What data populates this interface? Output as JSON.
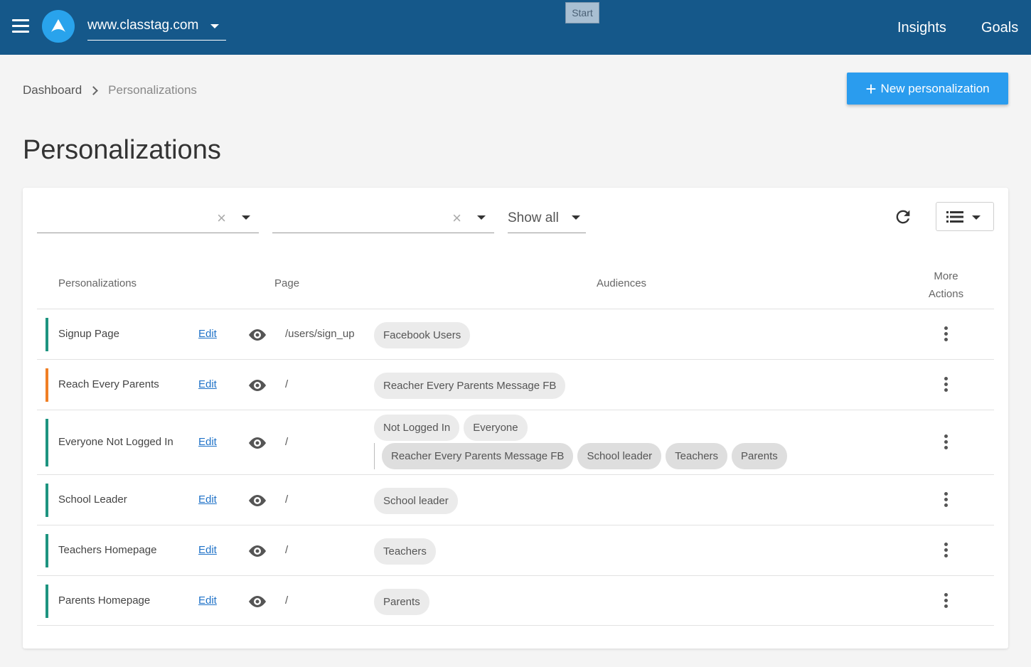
{
  "topbar": {
    "site": "www.classtag.com",
    "start_badge": "Start",
    "nav": {
      "insights": "Insights",
      "goals": "Goals"
    },
    "colors": {
      "bar": "#15588a",
      "logo": "#29a3ec"
    }
  },
  "breadcrumb": {
    "root": "Dashboard",
    "current": "Personalizations"
  },
  "actions": {
    "new_label": "New personalization"
  },
  "page_title": "Personalizations",
  "filters": {
    "status_label": "Show all"
  },
  "table": {
    "headers": {
      "name": "Personalizations",
      "page": "Page",
      "audiences": "Audiences",
      "more_line1": "More",
      "more_line2": "Actions"
    },
    "edit_label": "Edit",
    "rows": [
      {
        "name": "Signup Page",
        "path": "/users/sign_up",
        "color": "#1e9480",
        "audiences": [
          "Facebook Users"
        ],
        "audiences2": []
      },
      {
        "name": "Reach Every Parents",
        "path": "/",
        "color": "#f07f25",
        "audiences": [
          "Reacher Every Parents Message FB"
        ],
        "audiences2": []
      },
      {
        "name": "Everyone Not Logged In",
        "path": "/",
        "color": "#1e9480",
        "audiences": [
          "Not Logged In",
          "Everyone"
        ],
        "audiences2": [
          "Reacher Every Parents Message FB",
          "School leader",
          "Teachers",
          "Parents"
        ]
      },
      {
        "name": "School Leader",
        "path": "/",
        "color": "#1e9480",
        "audiences": [
          "School leader"
        ],
        "audiences2": []
      },
      {
        "name": "Teachers Homepage",
        "path": "/",
        "color": "#1e9480",
        "audiences": [
          "Teachers"
        ],
        "audiences2": []
      },
      {
        "name": "Parents Homepage",
        "path": "/",
        "color": "#1e9480",
        "audiences": [
          "Parents"
        ],
        "audiences2": []
      }
    ]
  }
}
